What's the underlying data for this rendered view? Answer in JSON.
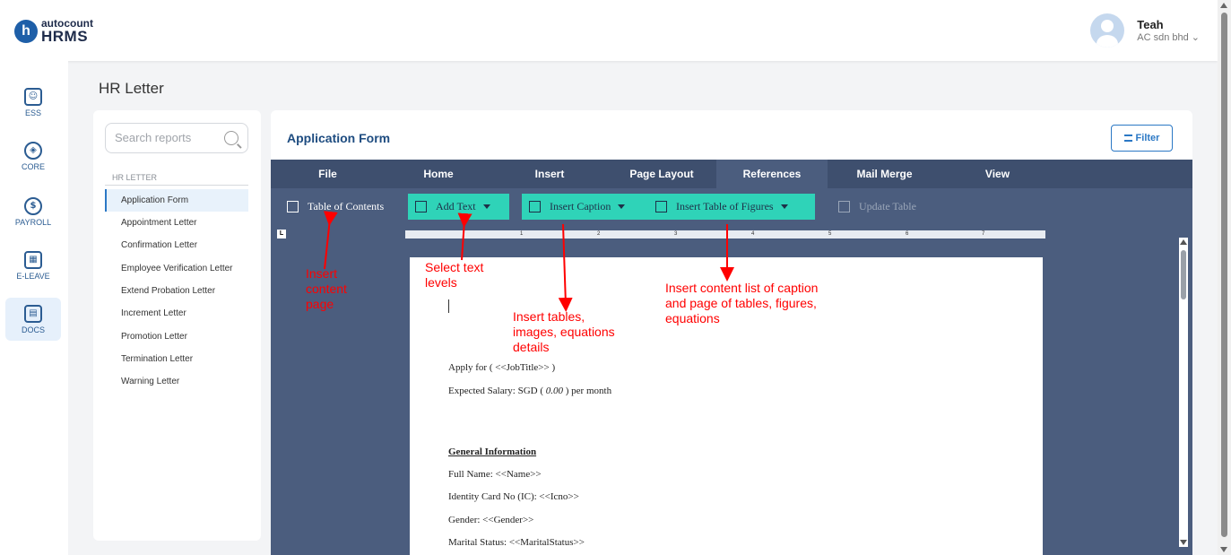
{
  "header": {
    "logo_top": "autocount",
    "logo_bottom": "HRMS",
    "logo_mark": "h",
    "user_name": "Teah",
    "user_company": "AC sdn bhd"
  },
  "rail": [
    {
      "label": "ESS",
      "icon": "ess-icon"
    },
    {
      "label": "CORE",
      "icon": "core-icon"
    },
    {
      "label": "PAYROLL",
      "icon": "payroll-icon"
    },
    {
      "label": "E-LEAVE",
      "icon": "eleave-icon"
    },
    {
      "label": "DOCS",
      "icon": "docs-icon"
    }
  ],
  "page_title": "HR Letter",
  "reports": {
    "search_placeholder": "Search reports",
    "section": "HR LETTER",
    "items": [
      "Application Form",
      "Appointment Letter",
      "Confirmation Letter",
      "Employee Verification Letter",
      "Extend Probation Letter",
      "Increment Letter",
      "Promotion Letter",
      "Termination Letter",
      "Warning Letter"
    ]
  },
  "document": {
    "title": "Application Form",
    "filter_label": "Filter",
    "tabs": [
      "File",
      "Home",
      "Insert",
      "Page Layout",
      "References",
      "Mail Merge",
      "View"
    ],
    "tools": {
      "toc": "Table of Contents",
      "add_text": "Add Text",
      "insert_caption": "Insert Caption",
      "insert_tof": "Insert Table of Figures",
      "update_table": "Update Table"
    },
    "ruler_marks": [
      "1",
      "2",
      "3",
      "4",
      "5",
      "6",
      "7"
    ],
    "ruler_corner": "L",
    "lines": {
      "apply": "Apply for ( <<JobTitle>> )",
      "salary_prefix": "Expected Salary: SGD ( ",
      "salary_value": "0.00",
      "salary_suffix": " ) per month",
      "general_info": "General Information",
      "full_name": "Full Name: <<Name>>",
      "ic": "Identity Card No (IC): <<Icno>>",
      "gender": "Gender: <<Gender>>",
      "marital": "Marital Status: <<MaritalStatus>>"
    }
  },
  "annotations": {
    "toc": [
      "Insert",
      "content",
      "page"
    ],
    "add_text": [
      "Select text",
      "levels"
    ],
    "caption": [
      "Insert tables,",
      "images, equations",
      "details"
    ],
    "tof": [
      "Insert content list of caption",
      "and page of tables, figures,",
      "equations"
    ]
  },
  "colors": {
    "brand": "#1e5fa8",
    "ribbon": "#3e4f6e",
    "teal": "#2fd3b8",
    "annotation": "#ff0000"
  }
}
